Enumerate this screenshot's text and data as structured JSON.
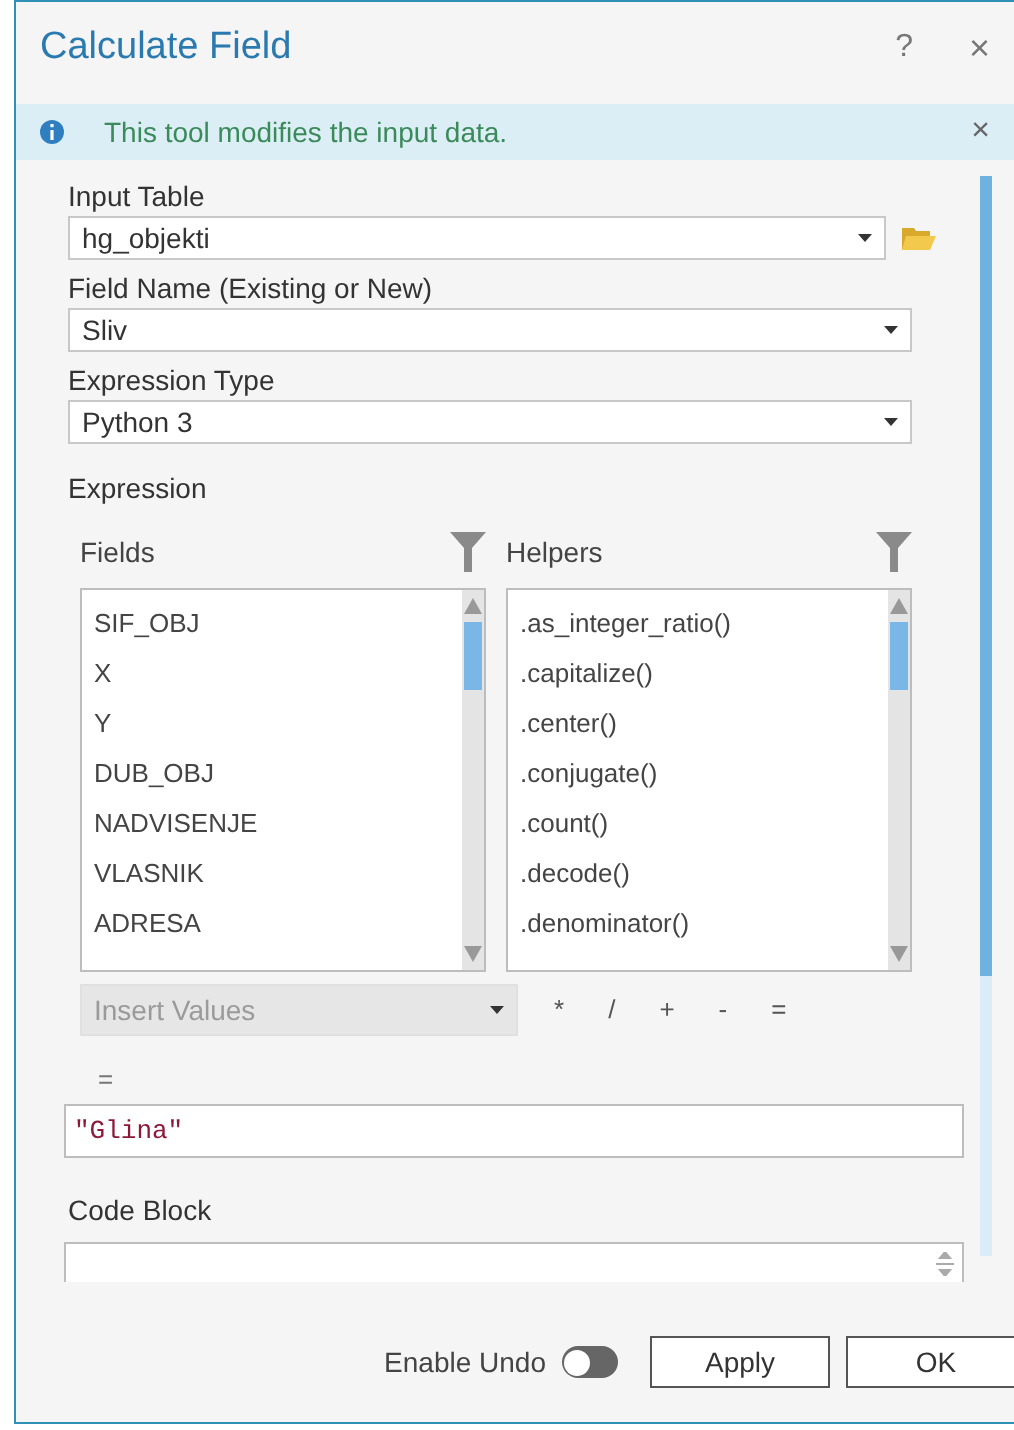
{
  "window": {
    "title": "Calculate Field",
    "help": "?",
    "close": "×"
  },
  "info_bar": {
    "message": "This tool modifies the input data.",
    "close": "×"
  },
  "input_table": {
    "label": "Input Table",
    "value": "hg_objekti"
  },
  "field_name": {
    "label": "Field Name (Existing or New)",
    "value": "Sliv"
  },
  "expression_type": {
    "label": "Expression Type",
    "value": "Python 3"
  },
  "expression": {
    "label": "Expression",
    "fields": {
      "title": "Fields",
      "items": [
        "SIF_OBJ",
        "X",
        "Y",
        "DUB_OBJ",
        "NADVISENJE",
        "VLASNIK",
        "ADRESA"
      ]
    },
    "helpers": {
      "title": "Helpers",
      "items": [
        ".as_integer_ratio()",
        ".capitalize()",
        ".center()",
        ".conjugate()",
        ".count()",
        ".decode()",
        ".denominator()"
      ]
    },
    "insert_values": {
      "label": "Insert Values",
      "disabled": true
    },
    "operators": [
      "*",
      "/",
      "+",
      "-",
      "="
    ],
    "assign": "=",
    "value": "\"Glina\""
  },
  "code_block": {
    "label": "Code Block"
  },
  "footer": {
    "enable_undo": {
      "label": "Enable Undo",
      "on": false
    },
    "buttons": [
      "Apply",
      "OK"
    ]
  }
}
